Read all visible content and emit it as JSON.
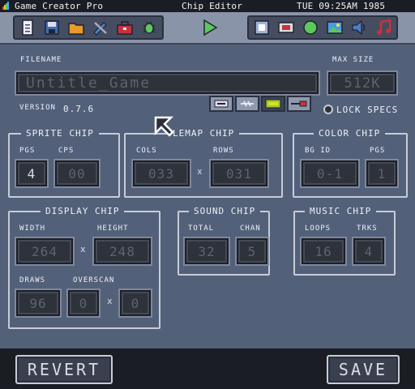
{
  "menubar": {
    "app_name": "Game Creator Pro",
    "editor_name": "Chip Editor",
    "clock": "TUE 09:25AM 1985"
  },
  "toolbar": {
    "left_group": [
      "file-icon",
      "save-disk-icon",
      "folder-icon",
      "tools-icon",
      "toolbox-icon",
      "bug-icon"
    ],
    "play": "play-icon",
    "right_group": [
      "chip-icon",
      "display-icon",
      "sprite-icon",
      "image-icon",
      "speaker-icon",
      "music-note-icon"
    ]
  },
  "file": {
    "filename_label": "FILENAME",
    "filename_value": "Untitle_Game",
    "maxsize_label": "MAX SIZE",
    "maxsize_value": "512K",
    "version_label": "VERSION",
    "version_value": "0.7.6",
    "lock_label": "LOCK SPECS"
  },
  "mini_tools": [
    "drive-icon",
    "link-icon",
    "cartridge-icon",
    "plug-icon"
  ],
  "sprite_chip": {
    "title": "SPRITE CHIP",
    "pgs_label": "PGS",
    "pgs_value": "4",
    "cps_label": "CPS",
    "cps_value": "00"
  },
  "tilemap_chip": {
    "title": "LEMAP CHIP",
    "cols_label": "COLS",
    "cols_value": "033",
    "rows_label": "ROWS",
    "rows_value": "031",
    "times": "x"
  },
  "color_chip": {
    "title": "COLOR CHIP",
    "bgid_label": "BG ID",
    "bgid_value": "0-1",
    "pgs_label": "PGS",
    "pgs_value": "1"
  },
  "display_chip": {
    "title": "DISPLAY CHIP",
    "width_label": "WIDTH",
    "width_value": "264",
    "height_label": "HEIGHT",
    "height_value": "248",
    "draws_label": "DRAWS",
    "draws_value": "96",
    "overscan_label": "OVERSCAN",
    "overscan_a": "0",
    "overscan_b": "0",
    "times": "x"
  },
  "sound_chip": {
    "title": "SOUND CHIP",
    "total_label": "TOTAL",
    "total_value": "32",
    "chan_label": "CHAN",
    "chan_value": "5"
  },
  "music_chip": {
    "title": "MUSIC CHIP",
    "loops_label": "LOOPS",
    "loops_value": "16",
    "trks_label": "TRKS",
    "trks_value": "4"
  },
  "buttons": {
    "revert": "REVERT",
    "save": "SAVE"
  },
  "colors": {
    "background": "#536079",
    "menubar": "#1b1d24",
    "toolbar": "#8a94a9",
    "field_bg": "#2d323b"
  }
}
